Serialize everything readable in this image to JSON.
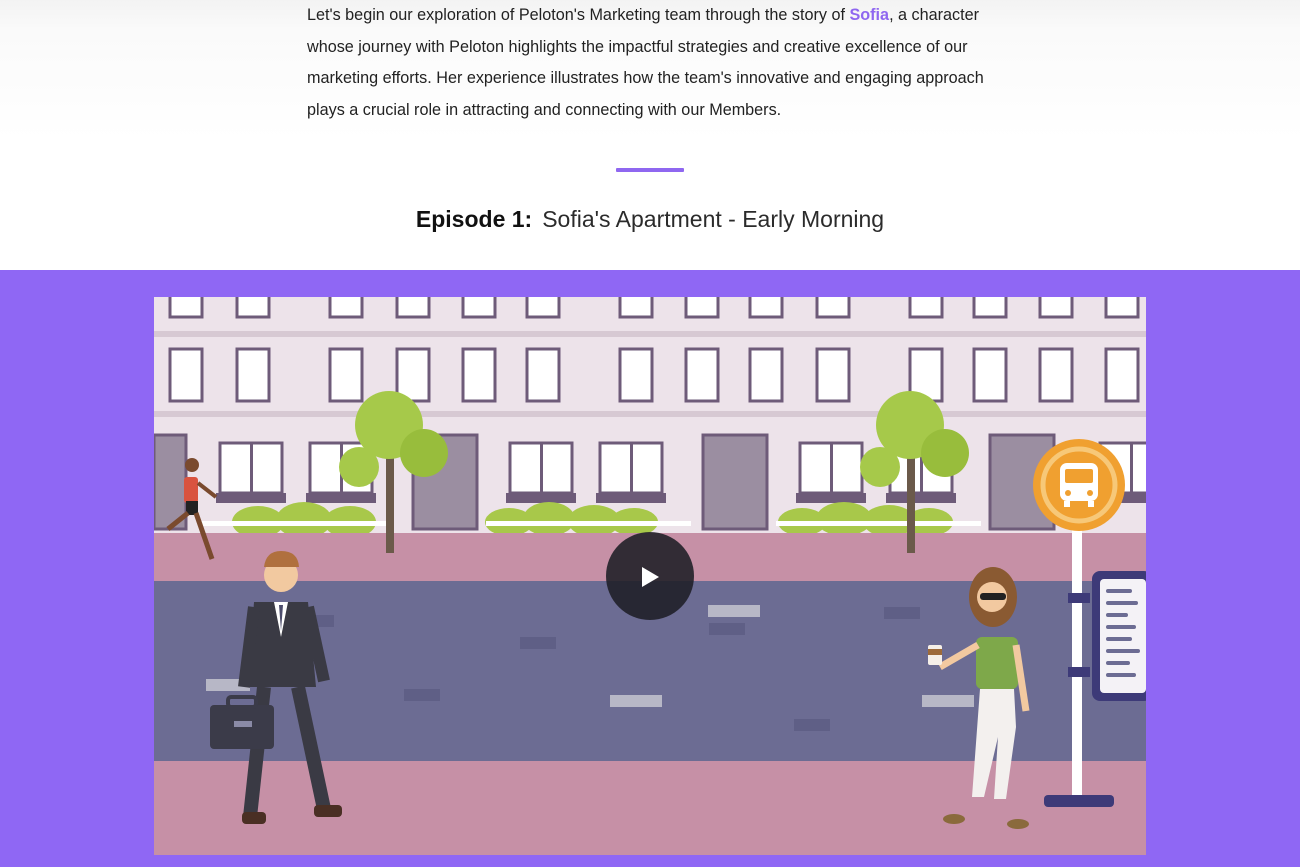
{
  "intro": {
    "before": "Let's begin our exploration of Peloton's Marketing team through the story of ",
    "highlight": "Sofia",
    "after": ", a character whose journey with Peloton highlights the impactful strategies and creative excellence of our marketing efforts. Her experience illustrates how the team's innovative and engaging approach plays a crucial role in attracting and connecting with our Members."
  },
  "episode": {
    "label": "Episode 1:",
    "title": "Sofia's Apartment - Early Morning"
  },
  "video": {
    "play_icon": "play-icon",
    "illustration_icons": [
      "bus-stop-icon",
      "bus-schedule-sign"
    ]
  },
  "colors": {
    "accent": "#8f67f0",
    "band": "#8f67f4",
    "building": "#ede3ea",
    "road": "#6c6c93",
    "sidewalk": "#c690a6"
  }
}
